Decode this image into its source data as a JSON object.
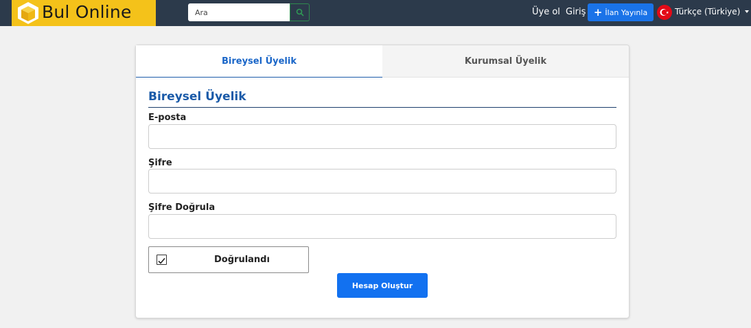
{
  "header": {
    "brand": "Bul Online",
    "search_placeholder": "Ara",
    "nav": {
      "register": "Üye ol",
      "login": "Giriş",
      "post_listing": "İlan Yayınla",
      "language": "Türkçe (Türkiye)"
    },
    "colors": {
      "bar": "#2c3a4b",
      "logo": "#f4c21a",
      "post_button": "#1a73e8",
      "flag": "#e30a17"
    }
  },
  "tabs": [
    {
      "label": "Bireysel Üyelik",
      "active": true
    },
    {
      "label": "Kurumsal Üyelik",
      "active": false
    }
  ],
  "form": {
    "title": "Bireysel Üyelik",
    "fields": [
      {
        "label": "E-posta",
        "value": ""
      },
      {
        "label": "Şifre",
        "value": ""
      },
      {
        "label": "Şifre Doğrula",
        "value": ""
      }
    ],
    "verification": {
      "label": "Doğrulandı",
      "checked": true
    },
    "submit_label": "Hesap Oluştur"
  },
  "icons": {
    "logo": "cube-logo-icon",
    "search": "search-icon",
    "plus": "plus-icon",
    "flag": "turkey-flag-icon",
    "caret": "caret-down-icon",
    "checkbox": "checkbox-checked-icon"
  },
  "accent_color": "#1271f0"
}
